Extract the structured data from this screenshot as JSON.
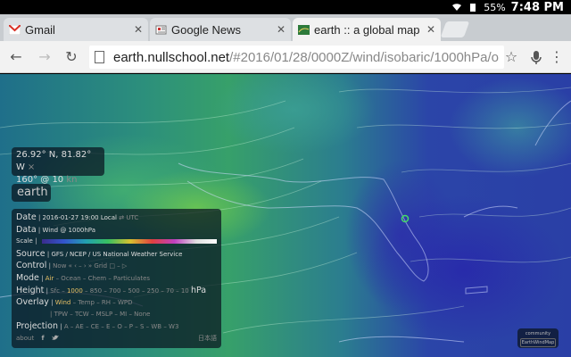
{
  "status_bar": {
    "battery": "55%",
    "time": "7:48 PM"
  },
  "tabs": [
    {
      "title": "Gmail",
      "favicon": "gmail-icon"
    },
    {
      "title": "Google News",
      "favicon": "news-icon"
    },
    {
      "title": "earth :: a global map",
      "favicon": "earth-icon",
      "active": true
    }
  ],
  "address_bar": {
    "host": "earth.nullschool.net",
    "path": "/#2016/01/28/0000Z/wind/isobaric/1000hPa/o"
  },
  "coords_panel": {
    "location": "26.92° N, 81.82° W",
    "close": "×",
    "wind": "160° @ 10",
    "wind_unit": "kn"
  },
  "brand": "earth",
  "menu": {
    "date_label": "Date",
    "date_value": "2016-01-27 19:00 Local",
    "date_utc": "⇄ UTC",
    "data_label": "Data",
    "data_value": "Wind @ 1000hPa",
    "scale_label": "Scale",
    "source_label": "Source",
    "source_value": "GFS / NCEP / US National Weather Service",
    "control_label": "Control",
    "control_value": "Now  «  ‹  –  ›  »  Grid  □ – ▷",
    "mode_label": "Mode",
    "mode_active": "Air",
    "mode_rest": "– Ocean – Chem – Particulates",
    "height_label": "Height",
    "height_sfc": "Sfc –",
    "height_active": "1000",
    "height_rest": "– 850 – 700 – 500 – 250 – 70 – 10",
    "height_unit": "hPa",
    "overlay_label": "Overlay",
    "overlay_active": "Wind",
    "overlay_rest": "– Temp – RH – WPD",
    "overlay_row2": "| TPW – TCW – MSLP – MI – None",
    "projection_label": "Projection",
    "projection_value": "A – AE – CE – E – O – P – S – WB – W3",
    "about": "about",
    "lang": "日本語"
  },
  "community": {
    "label": "community",
    "button": "EarthWindMap"
  },
  "colors": {
    "accent": "#e8c064",
    "panel": "#0a141e",
    "marker": "#44dd66"
  }
}
